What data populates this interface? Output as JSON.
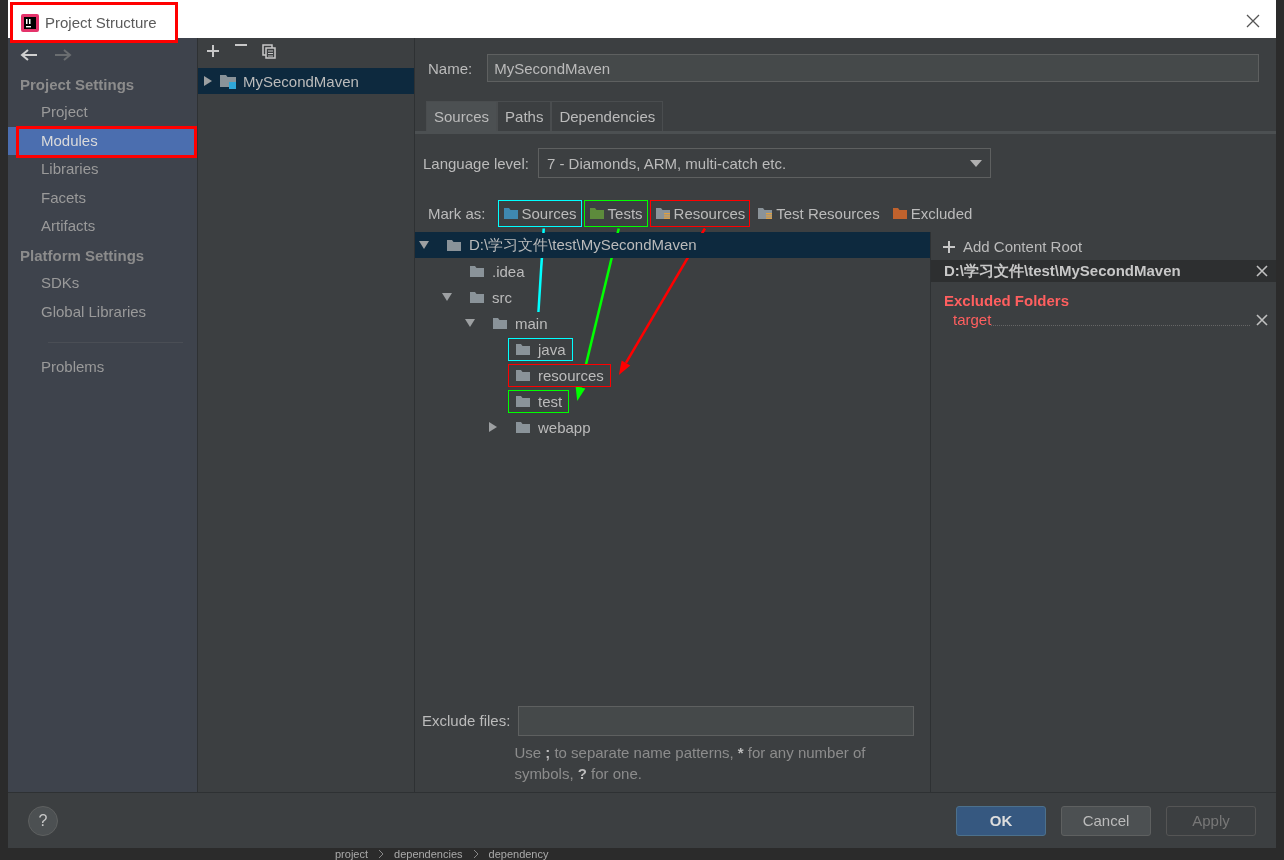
{
  "window": {
    "title": "Project Structure",
    "annotation": {
      "color": "#ff0000"
    }
  },
  "sidebar": {
    "sections": [
      {
        "heading": "Project Settings",
        "items": [
          {
            "label": "Project",
            "selected": false
          },
          {
            "label": "Modules",
            "selected": true,
            "annotation": {
              "color": "#ff0000"
            }
          },
          {
            "label": "Libraries",
            "selected": false
          },
          {
            "label": "Facets",
            "selected": false
          },
          {
            "label": "Artifacts",
            "selected": false
          }
        ]
      },
      {
        "heading": "Platform Settings",
        "items": [
          {
            "label": "SDKs",
            "selected": false
          },
          {
            "label": "Global Libraries",
            "selected": false
          }
        ]
      },
      {
        "items": [
          {
            "label": "Problems",
            "selected": false
          }
        ]
      }
    ]
  },
  "modules": [
    {
      "label": "MySecondMaven",
      "expanded": false,
      "selected": true
    }
  ],
  "name_field": {
    "label": "Name:",
    "value": "MySecondMaven"
  },
  "tabs": [
    {
      "label": "Sources",
      "selected": true
    },
    {
      "label": "Paths",
      "selected": false
    },
    {
      "label": "Dependencies",
      "selected": false
    }
  ],
  "language_level": {
    "label": "Language level:",
    "value": "7 - Diamonds, ARM, multi-catch etc."
  },
  "mark_as": {
    "label": "Mark as:",
    "options": [
      {
        "label": "Sources",
        "color": "#3f88b0",
        "annotation": {
          "color": "#00ffff"
        }
      },
      {
        "label": "Tests",
        "color": "#5d8b3c",
        "annotation": {
          "color": "#00ff00"
        }
      },
      {
        "label": "Resources",
        "color": "#8a9399",
        "annotation": {
          "color": "#ff0000"
        }
      },
      {
        "label": "Test Resources",
        "color": "#8a9399"
      },
      {
        "label": "Excluded",
        "color": "#c0622d"
      }
    ]
  },
  "tree": [
    {
      "label": "D:\\学习文件\\test\\MySecondMaven",
      "expanded": true,
      "selected": true,
      "children": [
        {
          "label": ".idea",
          "selected": false
        },
        {
          "label": "src",
          "expanded": true,
          "selected": false,
          "children": [
            {
              "label": "main",
              "expanded": true,
              "selected": false,
              "children": [
                {
                  "label": "java",
                  "selected": false,
                  "annotation": {
                    "color": "#00ffff"
                  }
                },
                {
                  "label": "resources",
                  "selected": false,
                  "annotation": {
                    "color": "#ff0000"
                  }
                },
                {
                  "label": "test",
                  "selected": false,
                  "annotation": {
                    "color": "#00ff00"
                  }
                },
                {
                  "label": "webapp",
                  "expanded": false,
                  "selected": false
                }
              ]
            }
          ]
        }
      ]
    }
  ],
  "exclude_files": {
    "label": "Exclude files:",
    "hint": [
      {
        "text": "Use "
      },
      {
        "text": ";",
        "bold": true
      },
      {
        "text": " to separate name patterns, "
      },
      {
        "text": "*",
        "bold": true
      },
      {
        "text": " for any number of symbols, "
      },
      {
        "text": "?",
        "bold": true
      },
      {
        "text": " for one."
      }
    ]
  },
  "content_root": {
    "add_label": "Add Content Root",
    "path": "D:\\学习文件\\test\\MySecondMaven",
    "excluded_heading": "Excluded Folders",
    "excluded": [
      "target"
    ]
  },
  "help": "?",
  "buttons": [
    {
      "label": "OK",
      "default": true,
      "disabled": false
    },
    {
      "label": "Cancel",
      "default": false,
      "disabled": false
    },
    {
      "label": "Apply",
      "default": false,
      "disabled": true
    }
  ],
  "breadcrumbs": [
    "project",
    "dependencies",
    "dependency"
  ]
}
